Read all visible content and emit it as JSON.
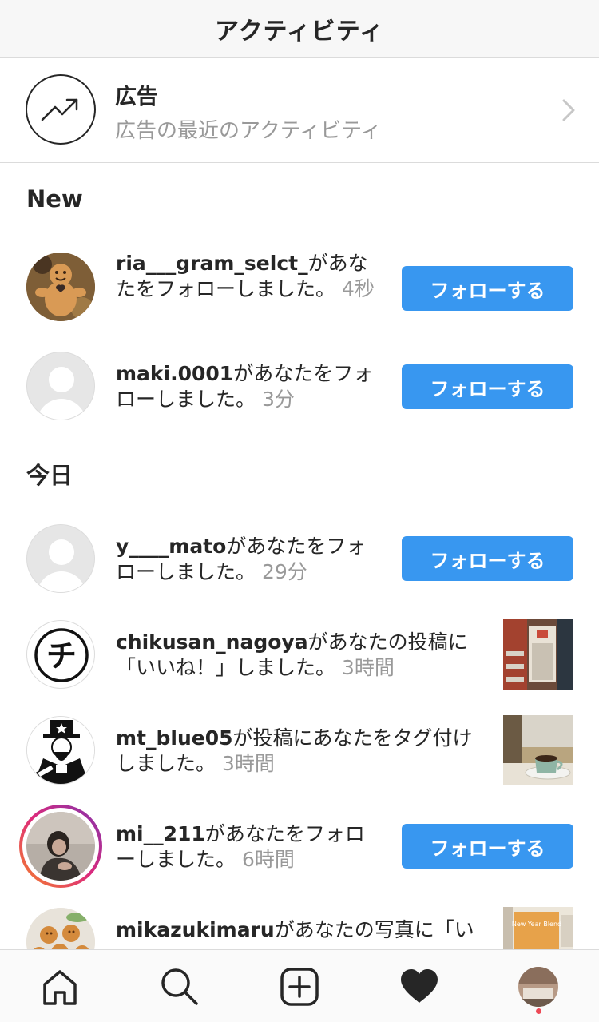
{
  "header": {
    "title": "アクティビティ"
  },
  "ads": {
    "icon": "trending-up-icon",
    "title": "広告",
    "subtitle": "広告の最近のアクティビティ",
    "chevron": "chevron-right-icon"
  },
  "sections": {
    "new": "New",
    "today": "今日"
  },
  "items": [
    {
      "username": "ria___gram_selct_",
      "text": "があなたをフォローしました。",
      "time": "4秒",
      "action": "フォローする",
      "avatar": "gingerbread-cookie-photo"
    },
    {
      "username": "maki.0001",
      "text": "があなたをフォローしました。",
      "time": "3分",
      "action": "フォローする",
      "avatar": "default-avatar-icon"
    },
    {
      "username": "y____mato",
      "text": "があなたをフォローしました。",
      "time": "29分",
      "action": "フォローする",
      "avatar": "default-avatar-icon"
    },
    {
      "username": "chikusan_nagoya",
      "text": "があなたの投稿に「いいね！」しました。",
      "time": "3時間",
      "avatar": "chi-logo",
      "thumbnail": "store-interior-photo"
    },
    {
      "username": "mt_blue05",
      "text": "が投稿にあなたをタグ付けしました。",
      "time": "3時間",
      "avatar": "uncle-sam-illustration",
      "thumbnail": "coffee-cup-photo"
    },
    {
      "username": "mi__211",
      "text": "があなたをフォローしました。",
      "time": "6時間",
      "action": "フォローする",
      "avatar": "person-portrait-photo"
    },
    {
      "username": "mikazukimaru",
      "text": "があなたの写真に「い",
      "avatar": "cookies-photo",
      "thumbnail": "new-year-blend-photo"
    }
  ],
  "avatar_logo_text": "チ",
  "thumbnail_text": "New Year Blend",
  "nav": [
    {
      "name": "home-icon"
    },
    {
      "name": "search-icon"
    },
    {
      "name": "add-post-icon"
    },
    {
      "name": "heart-icon"
    },
    {
      "name": "profile-avatar"
    }
  ],
  "colors": {
    "accent": "#3897f0",
    "muted": "#999999",
    "text": "#262626",
    "notification": "#ed4956"
  }
}
